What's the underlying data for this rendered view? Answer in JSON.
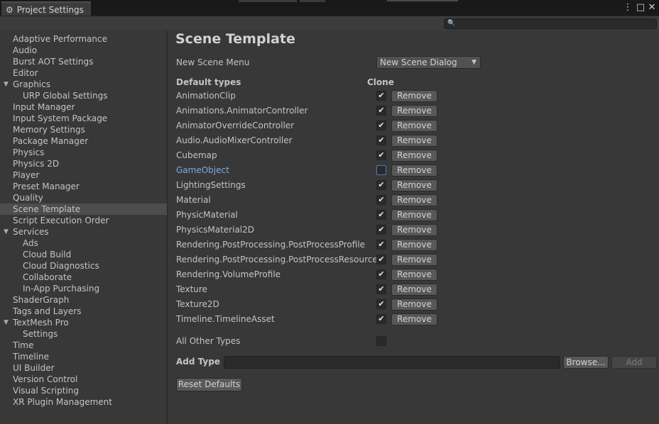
{
  "window": {
    "tab_title": "Project Settings",
    "gear_icon": "gear-icon",
    "menu_icon": "⋮",
    "maximize_icon": "□",
    "close_icon": "✕"
  },
  "search": {
    "placeholder": "",
    "icon": "🔍"
  },
  "sidebar": {
    "items": [
      {
        "label": "Adaptive Performance",
        "level": 0
      },
      {
        "label": "Audio",
        "level": 0
      },
      {
        "label": "Burst AOT Settings",
        "level": 0
      },
      {
        "label": "Editor",
        "level": 0
      },
      {
        "label": "Graphics",
        "level": 0,
        "expanded": true
      },
      {
        "label": "URP Global Settings",
        "level": 1
      },
      {
        "label": "Input Manager",
        "level": 0
      },
      {
        "label": "Input System Package",
        "level": 0
      },
      {
        "label": "Memory Settings",
        "level": 0
      },
      {
        "label": "Package Manager",
        "level": 0
      },
      {
        "label": "Physics",
        "level": 0
      },
      {
        "label": "Physics 2D",
        "level": 0
      },
      {
        "label": "Player",
        "level": 0
      },
      {
        "label": "Preset Manager",
        "level": 0
      },
      {
        "label": "Quality",
        "level": 0
      },
      {
        "label": "Scene Template",
        "level": 0,
        "selected": true
      },
      {
        "label": "Script Execution Order",
        "level": 0
      },
      {
        "label": "Services",
        "level": 0,
        "expanded": true
      },
      {
        "label": "Ads",
        "level": 1
      },
      {
        "label": "Cloud Build",
        "level": 1
      },
      {
        "label": "Cloud Diagnostics",
        "level": 1
      },
      {
        "label": "Collaborate",
        "level": 1
      },
      {
        "label": "In-App Purchasing",
        "level": 1
      },
      {
        "label": "ShaderGraph",
        "level": 0
      },
      {
        "label": "Tags and Layers",
        "level": 0
      },
      {
        "label": "TextMesh Pro",
        "level": 0,
        "expanded": true
      },
      {
        "label": "Settings",
        "level": 1
      },
      {
        "label": "Time",
        "level": 0
      },
      {
        "label": "Timeline",
        "level": 0
      },
      {
        "label": "UI Builder",
        "level": 0
      },
      {
        "label": "Version Control",
        "level": 0
      },
      {
        "label": "Visual Scripting",
        "level": 0
      },
      {
        "label": "XR Plugin Management",
        "level": 0
      }
    ]
  },
  "main": {
    "title": "Scene Template",
    "new_scene_menu_label": "New Scene Menu",
    "new_scene_menu_value": "New Scene Dialog",
    "default_types_header": "Default types",
    "clone_header": "Clone",
    "remove_label": "Remove",
    "types": [
      {
        "name": "AnimationClip",
        "clone": true
      },
      {
        "name": "Animations.AnimatorController",
        "clone": true
      },
      {
        "name": "AnimatorOverrideController",
        "clone": true
      },
      {
        "name": "Audio.AudioMixerController",
        "clone": true
      },
      {
        "name": "Cubemap",
        "clone": true
      },
      {
        "name": "GameObject",
        "clone": false,
        "highlighted": true
      },
      {
        "name": "LightingSettings",
        "clone": true
      },
      {
        "name": "Material",
        "clone": true
      },
      {
        "name": "PhysicMaterial",
        "clone": true
      },
      {
        "name": "PhysicsMaterial2D",
        "clone": true
      },
      {
        "name": "Rendering.PostProcessing.PostProcessProfile",
        "clone": true
      },
      {
        "name": "Rendering.PostProcessing.PostProcessResources",
        "clone": true
      },
      {
        "name": "Rendering.VolumeProfile",
        "clone": true
      },
      {
        "name": "Texture",
        "clone": true
      },
      {
        "name": "Texture2D",
        "clone": true
      },
      {
        "name": "Timeline.TimelineAsset",
        "clone": true
      }
    ],
    "all_other_types_label": "All Other Types",
    "all_other_types_checked": false,
    "add_type_label": "Add Type",
    "add_type_value": "",
    "browse_label": "Browse...",
    "add_label": "Add",
    "reset_defaults_label": "Reset Defaults"
  }
}
